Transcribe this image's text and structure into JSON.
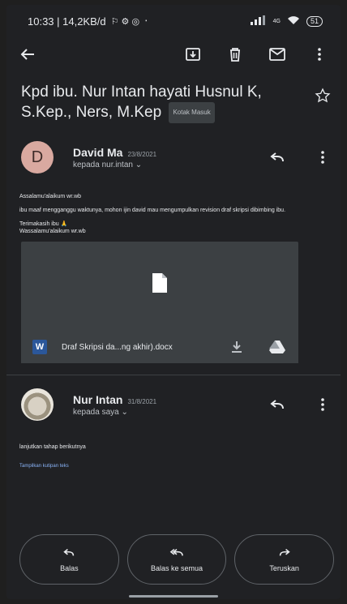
{
  "status_bar": {
    "time_speed": "10:33 | 14,2KB/d",
    "extra": "⋅",
    "signal": "4G",
    "battery": "51"
  },
  "subject": {
    "title": "Kpd ibu. Nur Intan hayati Husnul K, S.Kep., Ners, M.Kep",
    "label": "Kotak Masuk"
  },
  "message1": {
    "avatar_letter": "D",
    "sender": "David Ma",
    "date": "23/8/2021",
    "recipient": "kepada nur.intan",
    "greeting": "Assalamu'alaikum wr.wb",
    "body": "ibu maaf mengganggu waktunya, mohon ijin david mau mengumpulkan revision draf skripsi dibimbing ibu.",
    "closing1": "Terimakasih ibu 🙏",
    "closing2": "Wassalamu'alaikum wr.wb",
    "attachment_name": "Draf Skripsi da...ng akhir).docx",
    "attachment_type": "W"
  },
  "message2": {
    "sender": "Nur Intan",
    "date": "31/8/2021",
    "recipient": "kepada saya",
    "body": "lanjutkan tahap berikutnya",
    "show_quoted": "Tampilkan kutipan teks"
  },
  "actions": {
    "reply": "Balas",
    "reply_all": "Balas ke semua",
    "forward": "Teruskan"
  }
}
